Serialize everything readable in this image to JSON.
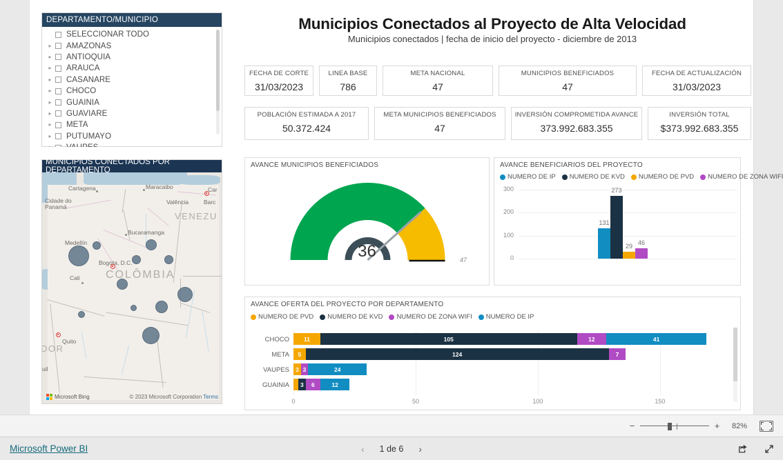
{
  "slicer": {
    "header": "DEPARTAMENTO/MUNICIPIO",
    "items": [
      {
        "label": "SELECCIONAR TODO",
        "expandable": false
      },
      {
        "label": "AMAZONAS",
        "expandable": true
      },
      {
        "label": "ANTIOQUIA",
        "expandable": true
      },
      {
        "label": "ARAUCA",
        "expandable": true
      },
      {
        "label": "CASANARE",
        "expandable": true
      },
      {
        "label": "CHOCO",
        "expandable": true
      },
      {
        "label": "GUAINIA",
        "expandable": true
      },
      {
        "label": "GUAVIARE",
        "expandable": true
      },
      {
        "label": "META",
        "expandable": true
      },
      {
        "label": "PUTUMAYO",
        "expandable": true
      },
      {
        "label": "VAUPES",
        "expandable": true
      }
    ]
  },
  "map": {
    "header": "MUNICIPIOS CONECTADOS POR DEPARTAMENTO",
    "provider": "Microsoft Bing",
    "attribution": "© 2023 Microsoft Corporation",
    "terms": "Terms",
    "labels": [
      "Cartagena",
      "Maracaibo",
      "Car",
      "Cidade do",
      "Panamá",
      "Valência",
      "Barc",
      "VENEZU",
      "Bucaramanga",
      "Medellín",
      "Bogota, D.C.",
      "Cali",
      "COLÔMBIA",
      "Quito",
      "DOR",
      "uil"
    ]
  },
  "header": {
    "title": "Municipios Conectados al Proyecto de Alta Velocidad",
    "subtitle": "Municipios conectados | fecha de inicio del proyecto - diciembre de 2013"
  },
  "kpis": [
    {
      "label": "FECHA DE CORTE",
      "value": "31/03/2023"
    },
    {
      "label": "LINEA BASE",
      "value": "786"
    },
    {
      "label": "META NACIONAL",
      "value": "47"
    },
    {
      "label": "MUNICIPIOS BENEFICIADOS",
      "value": "47"
    },
    {
      "label": "FECHA DE ACTUALIZACIÓN",
      "value": "31/03/2023"
    },
    {
      "label": "POBLACIÓN ESTIMADA A 2017",
      "value": "50.372.424"
    },
    {
      "label": "META MUNICIPIOS BENEFICIADOS",
      "value": "47"
    },
    {
      "label": "INVERSIÓN COMPROMETIDA AVANCE",
      "value": "373.992.683.355"
    },
    {
      "label": "INVERSIÓN TOTAL",
      "value": "$373.992.683.355"
    }
  ],
  "chart_data": [
    {
      "type": "gauge",
      "title": "AVANCE MUNICIPIOS BENEFICIADOS",
      "value": 36,
      "min": 0,
      "max": 47,
      "target": 47,
      "target_label": "47",
      "value_label": "36",
      "colors": {
        "filled": "#00a550",
        "remaining": "#f5bc00",
        "needle": "#3a4a52"
      }
    },
    {
      "type": "bar",
      "title": "AVANCE BENEFICIARIOS DEL PROYECTO",
      "categories": [
        "NUMERO DE IP",
        "NUMERO DE KVD",
        "NUMERO DE PVD",
        "NUMERO DE ZONA WIFI"
      ],
      "values": [
        131,
        273,
        29,
        46
      ],
      "value_labels": [
        "131",
        "273",
        "29",
        "46"
      ],
      "colors": [
        "#118dc2",
        "#1b3244",
        "#f5a700",
        "#b14bc4"
      ],
      "ylim": [
        0,
        300
      ],
      "yticks": [
        "0",
        "100",
        "200",
        "300"
      ],
      "xlabel": "",
      "ylabel": "",
      "legend": [
        {
          "label": "NUMERO DE IP",
          "color": "#118dc2"
        },
        {
          "label": "NUMERO DE KVD",
          "color": "#1b3244"
        },
        {
          "label": "NUMERO DE PVD",
          "color": "#f5a700"
        },
        {
          "label": "NUMERO DE ZONA WIFI",
          "color": "#b14bc4"
        }
      ],
      "grid": true,
      "legend_position": "top"
    },
    {
      "type": "bar",
      "orientation": "horizontal",
      "stacked": true,
      "title": "AVANCE OFERTA DEL PROYECTO POR DEPARTAMENTO",
      "categories": [
        "CHOCO",
        "META",
        "VAUPES",
        "GUAINIA"
      ],
      "series": [
        {
          "name": "NUMERO DE PVD",
          "color": "#f5a700",
          "values": [
            11,
            5,
            3,
            2
          ]
        },
        {
          "name": "NUMERO DE KVD",
          "color": "#1b3244",
          "values": [
            105,
            124,
            0,
            3
          ]
        },
        {
          "name": "NUMERO DE ZONA WIFI",
          "color": "#b14bc4",
          "values": [
            12,
            7,
            3,
            6
          ]
        },
        {
          "name": "NUMERO DE IP",
          "color": "#118dc2",
          "values": [
            41,
            0,
            24,
            12
          ]
        }
      ],
      "value_labels": {
        "CHOCO": [
          "11",
          "105",
          "12",
          "41"
        ],
        "META": [
          "5",
          "124",
          "7",
          ""
        ],
        "VAUPES": [
          "3",
          "",
          "3",
          "24"
        ],
        "GUAINIA": [
          "",
          "3",
          "6",
          "12"
        ]
      },
      "xlim": [
        0,
        178
      ],
      "xticks": [
        "0",
        "50",
        "100",
        "150"
      ],
      "legend": [
        {
          "label": "NUMERO DE PVD",
          "color": "#f5a700"
        },
        {
          "label": "NUMERO DE KVD",
          "color": "#1b3244"
        },
        {
          "label": "NUMERO DE ZONA WIFI",
          "color": "#b14bc4"
        },
        {
          "label": "NUMERO DE IP",
          "color": "#118dc2"
        }
      ],
      "grid": true,
      "legend_position": "top"
    }
  ],
  "toolbar": {
    "zoom_out": "−",
    "zoom_in": "+",
    "zoom_level": "82%"
  },
  "footer": {
    "brand": "Microsoft Power BI",
    "page_text": "1 de 6",
    "prev": "‹",
    "next": "›"
  }
}
